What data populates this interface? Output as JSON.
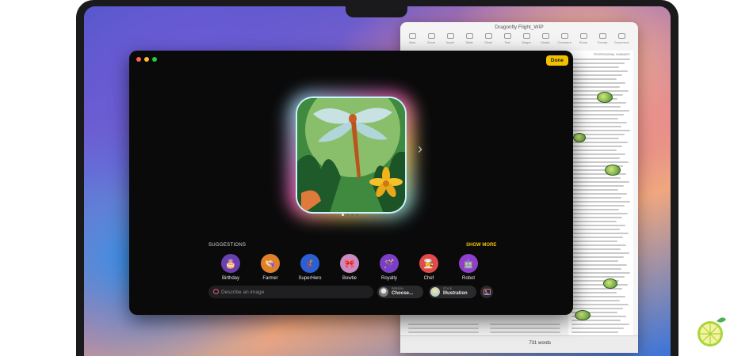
{
  "pages_window": {
    "title": "Dragonfly Flight_WIP",
    "toolbar": [
      "View",
      "Zoom",
      "Insert",
      "Table",
      "Chart",
      "Text",
      "Shape",
      "Media",
      "Comment",
      "Share",
      "Format",
      "Document"
    ],
    "word_count": "731 words",
    "page_header_label": "PROFESSIONAL SUMMARY"
  },
  "image_playground": {
    "done_label": "Done",
    "suggestions_label": "SUGGESTIONS",
    "show_more_label": "SHOW MORE",
    "suggestions": [
      {
        "label": "Birthday",
        "icon": "birthday-cake-icon",
        "bg": "#6a3fb0",
        "glyph": "🎂"
      },
      {
        "label": "Farmer",
        "icon": "farmer-hat-icon",
        "bg": "#e0812a",
        "glyph": "👒"
      },
      {
        "label": "SuperHero",
        "icon": "superhero-icon",
        "bg": "#2b5fd6",
        "glyph": "🦸"
      },
      {
        "label": "Bowtie",
        "icon": "bowtie-icon",
        "bg": "#c98bc2",
        "glyph": "🎀"
      },
      {
        "label": "Royalty",
        "icon": "crown-wand-icon",
        "bg": "#7a3fc6",
        "glyph": "🪄"
      },
      {
        "label": "Chef",
        "icon": "chef-hat-icon",
        "bg": "#e24a4a",
        "glyph": "🧑‍🍳"
      },
      {
        "label": "Robot",
        "icon": "robot-icon",
        "bg": "#8e3fd0",
        "glyph": "🤖"
      }
    ],
    "prompt_placeholder": "Describe an image",
    "person": {
      "key": "PERSON",
      "value": "Choose..."
    },
    "style": {
      "key": "STYLE",
      "value": "Illustration"
    },
    "page_indicator": {
      "count": 4,
      "active": 0
    }
  },
  "colors": {
    "accent": "#f2c200",
    "window_bg": "#0a0a0b"
  }
}
